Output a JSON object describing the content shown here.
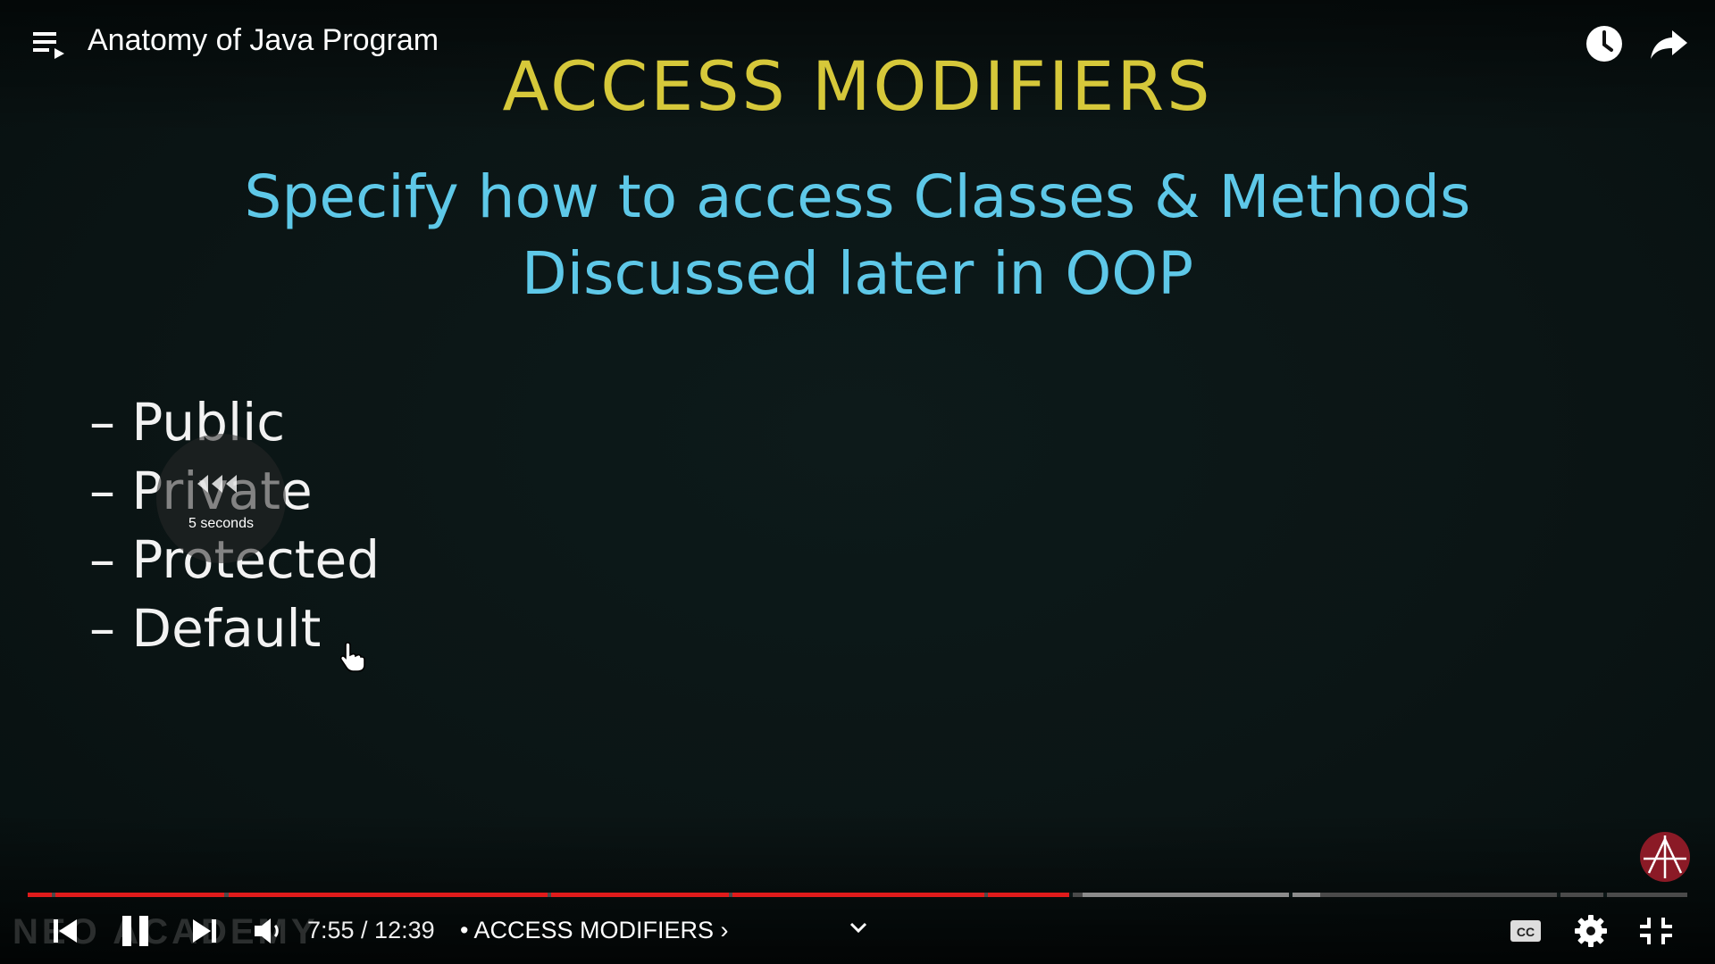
{
  "header": {
    "title": "Anatomy of Java Program"
  },
  "slide": {
    "heading": "ACCESS MODIFIERS",
    "subtitle_line1": "Specify how to access Classes & Methods",
    "subtitle_line2": "Discussed later in OOP",
    "bullets": [
      "– Public",
      "– Private",
      "– Protected",
      "– Default"
    ]
  },
  "seek_indicator": {
    "label": "5 seconds"
  },
  "watermark": "NEO ACADEMY",
  "controls": {
    "time": "7:55 / 12:39",
    "chapter": "• ACCESS MODIFIERS ›",
    "progress_fraction": 0.625
  },
  "icons": {
    "playlist": "playlist-icon",
    "watch_later": "clock-icon",
    "share": "share-arrow-icon",
    "prev": "skip-previous-icon",
    "pause": "pause-icon",
    "next": "skip-next-icon",
    "volume": "volume-icon",
    "expand": "chevron-down-icon",
    "captions": "cc-icon",
    "settings": "gear-icon",
    "exit_fullscreen": "exit-fullscreen-icon",
    "logo": "neso-logo-icon"
  },
  "colors": {
    "heading": "#d6c83a",
    "subtitle": "#5ec8e8",
    "bullet_text": "#f2f2f2",
    "progress_played": "#e01b1b",
    "progress_loaded": "#8c8c8c",
    "progress_track": "#4a4a4a",
    "logo": "#8b1a26"
  }
}
